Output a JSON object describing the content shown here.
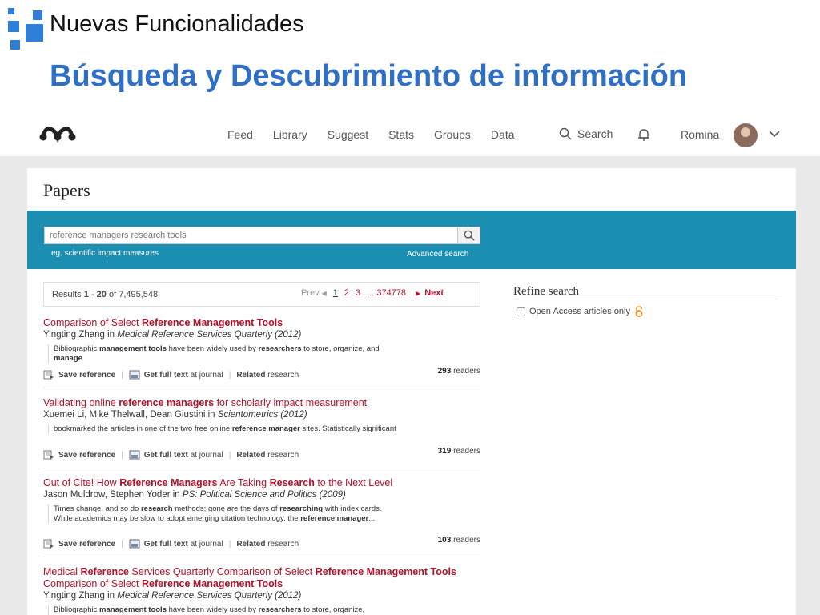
{
  "slide": {
    "supertitle": "Nuevas Funcionalidades",
    "title": "Búsqueda y Descubrimiento de información",
    "accent_color": "#2f6fc6"
  },
  "nav": {
    "links": [
      "Feed",
      "Library",
      "Suggest",
      "Stats",
      "Groups",
      "Data"
    ],
    "search_label": "Search",
    "user_name": "Romina"
  },
  "page": {
    "title": "Papers",
    "search": {
      "value": "reference managers research tools",
      "hint": "eg. scientific impact measures",
      "advanced": "Advanced search"
    },
    "results": {
      "prefix": "Results",
      "range": "1 - 20",
      "of": "of",
      "total": "7,495,548",
      "prev": "Prev",
      "pages": [
        "1",
        "2",
        "3",
        "...",
        "374778"
      ],
      "next": "Next"
    },
    "action_labels": {
      "save": "Save reference",
      "full_bold": "Get full text",
      "full_rest": "at journal",
      "related_bold": "Related",
      "related_rest": "research",
      "readers_suffix": "readers"
    },
    "items": [
      {
        "title_html": "Comparison of Select <span class=\"b\">Reference Management Tools</span>",
        "authors": "Yingting Zhang in ",
        "journal": "Medical Reference Services Quarterly (2012)",
        "snippet_html": "Bibliographic <span class=\"b\">management tools</span> have been widely used by <span class=\"b\">researchers</span> to store, organize, and <span class=\"b\">manage</span>",
        "readers": "293"
      },
      {
        "title_html": "Validating online <span class=\"b\">reference managers</span> for scholarly impact measurement",
        "authors": "Xuemei Li, Mike Thelwall, Dean Giustini in ",
        "journal": "Scientometrics (2012)",
        "snippet_html": "bookmarked the articles in one of the two free online <span class=\"b\">reference manager</span> sites. Statistically significant",
        "readers": "319"
      },
      {
        "title_html": "Out of Cite! How <span class=\"b\">Reference Managers</span> Are Taking <span class=\"b\">Research</span> to the Next Level",
        "authors": "Jason Muldrow, Stephen Yoder in ",
        "journal": "PS: Political Science and Politics (2009)",
        "snippet_html": "Times change, and so do <span class=\"b\">research</span> methods; gone are the days of <span class=\"b\">researching</span> with index cards. While academics may be slow to adopt emerging citation technology, the <span class=\"b\">reference manager</span>...",
        "readers": "103"
      },
      {
        "title_html": "Medical <span class=\"b\">Reference</span> Services Quarterly Comparison of Select <span class=\"b\">Reference Management Tools</span> Comparison of Select <span class=\"b\">Reference Management Tools</span>",
        "authors": "Yingting Zhang in ",
        "journal": "Medical Reference Services Quarterly (2012)",
        "snippet_html": "Bibliographic <span class=\"b\">management tools</span> have been widely used by <span class=\"b\">researchers</span> to store, organize,",
        "readers": ""
      }
    ],
    "refine": {
      "title": "Refine search",
      "open_access_label": "Open Access articles only"
    }
  }
}
